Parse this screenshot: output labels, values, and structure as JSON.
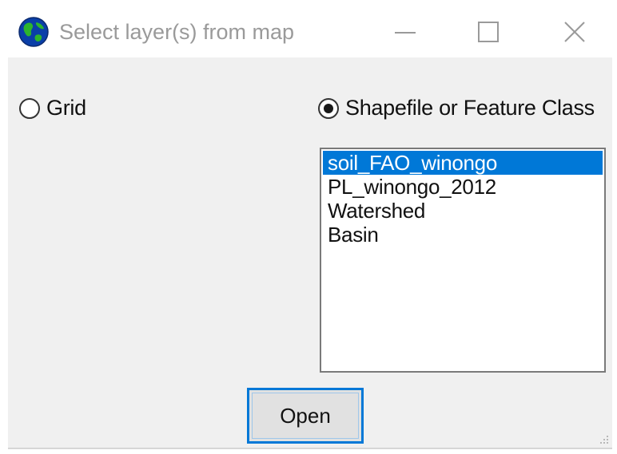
{
  "window": {
    "title": "Select layer(s) from map",
    "icon": "globe-icon",
    "controls": [
      "minimize-icon",
      "maximize-icon",
      "close-icon"
    ]
  },
  "options": {
    "grid_label": "Grid",
    "grid_checked": false,
    "shapefile_label": "Shapefile or Feature Class",
    "shapefile_checked": true
  },
  "layers": {
    "items": [
      "soil_FAO_winongo",
      "PL_winongo_2012",
      "Watershed",
      "Basin"
    ],
    "selected_index": 0
  },
  "buttons": {
    "open_label": "Open"
  },
  "colors": {
    "selection": "#0078d7",
    "focus_border": "#0078d7"
  }
}
